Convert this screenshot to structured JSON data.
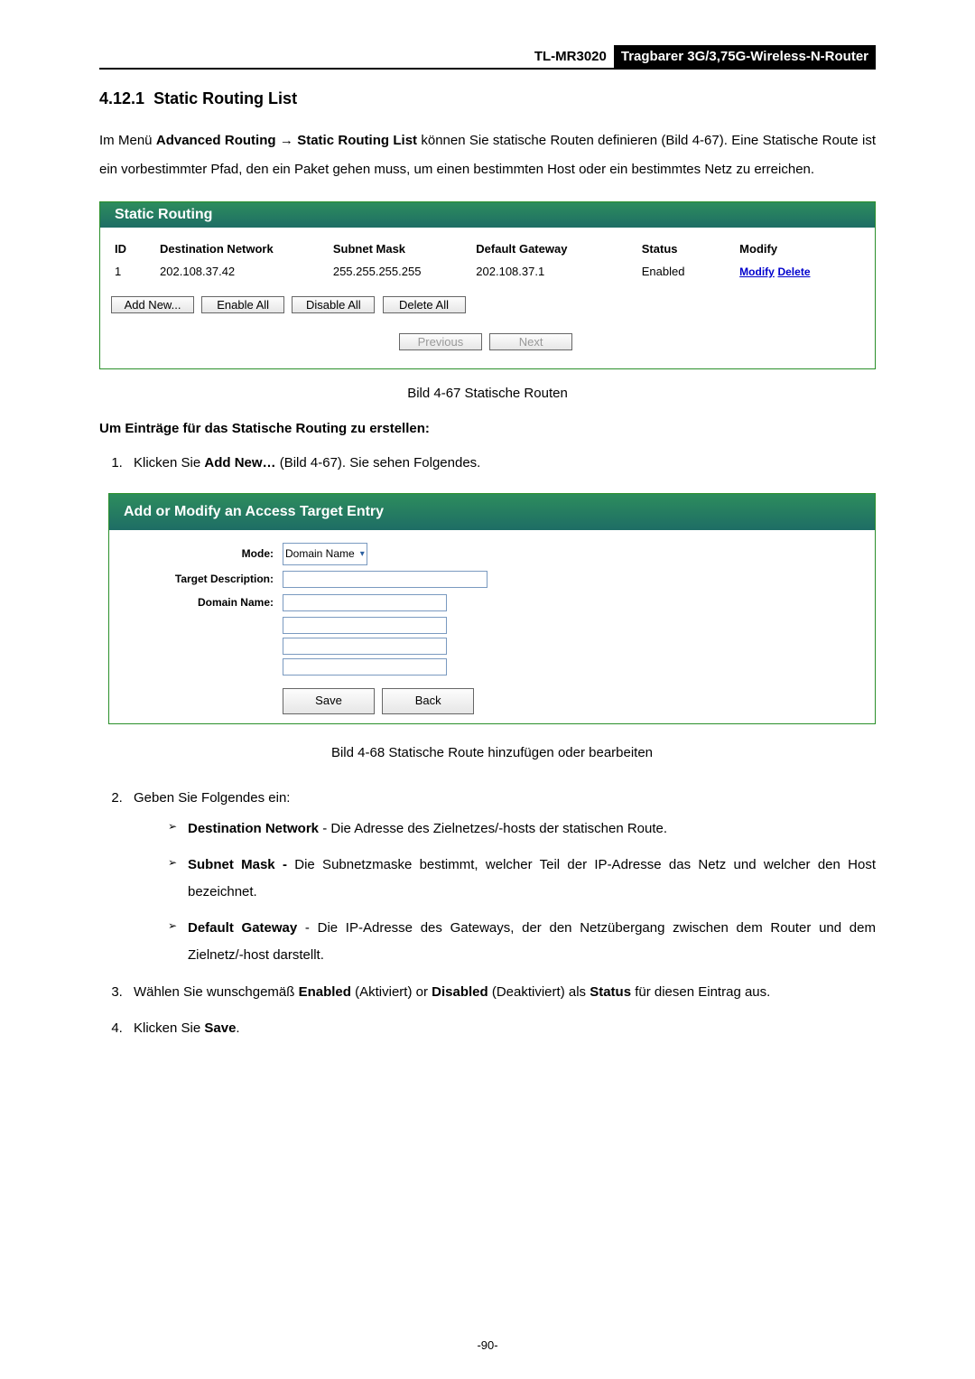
{
  "header": {
    "model": "TL-MR3020",
    "product": "Tragbarer 3G/3,75G-Wireless-N-Router"
  },
  "section": {
    "number": "4.12.1",
    "title": "Static Routing List"
  },
  "intro": {
    "prefix": "Im Menü ",
    "bold1": "Advanced Routing → Static Routing List",
    "rest": " können Sie statische Routen definieren (Bild 4-67). Eine Statische Route ist ein vorbestimmter Pfad, den ein Paket gehen muss, um einen bestimmten Host oder ein bestimmtes Netz zu erreichen."
  },
  "panel1": {
    "title": "Static Routing",
    "headers": [
      "ID",
      "Destination Network",
      "Subnet Mask",
      "Default Gateway",
      "Status",
      "Modify"
    ],
    "row": {
      "id": "1",
      "dest": "202.108.37.42",
      "mask": "255.255.255.255",
      "gw": "202.108.37.1",
      "status": "Enabled",
      "modify": "Modify",
      "delete": "Delete"
    },
    "buttons": {
      "add": "Add New...",
      "enable": "Enable All",
      "disable": "Disable All",
      "delete": "Delete All",
      "prev": "Previous",
      "next": "Next"
    }
  },
  "caption1": "Bild 4-67 Statische Routen",
  "subhead": "Um Einträge für das Statische Routing zu erstellen:",
  "step1": {
    "prefix": "Klicken Sie ",
    "bold": "Add New…",
    "rest": " (Bild 4-67). Sie sehen Folgendes."
  },
  "panel2": {
    "title": "Add or Modify an Access Target Entry",
    "labels": {
      "mode": "Mode:",
      "target": "Target Description:",
      "domain": "Domain Name:"
    },
    "mode_value": "Domain Name",
    "buttons": {
      "save": "Save",
      "back": "Back"
    }
  },
  "caption2": "Bild 4-68 Statische Route hinzufügen oder bearbeiten",
  "step2_intro": "Geben Sie Folgendes ein:",
  "bullets": {
    "b1_bold": "Destination Network",
    "b1_rest": " - Die Adresse des Zielnetzes/-hosts der statischen Route.",
    "b2_bold": "Subnet Mask -",
    "b2_rest": " Die Subnetzmaske bestimmt, welcher Teil der IP-Adresse das Netz und welcher den Host bezeichnet.",
    "b3_bold": "Default Gateway",
    "b3_rest": " - Die IP-Adresse des Gateways, der den Netzübergang zwischen dem Router und dem Zielnetz/-host darstellt."
  },
  "step3": {
    "p1": "Wählen Sie wunschgemäß ",
    "b1": "Enabled",
    "p2": " (Aktiviert) or ",
    "b2": "Disabled",
    "p3": " (Deaktiviert) als ",
    "b3": "Status",
    "p4": " für diesen Eintrag aus."
  },
  "step4": {
    "p1": "Klicken Sie ",
    "b1": "Save",
    "p2": "."
  },
  "page_number": "-90-"
}
